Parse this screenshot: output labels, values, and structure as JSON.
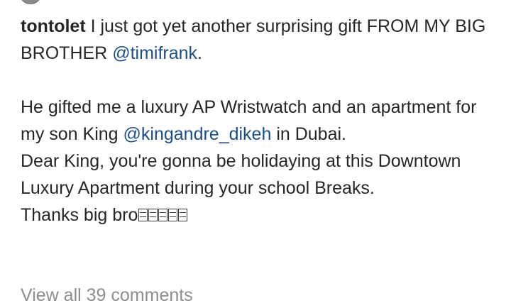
{
  "post": {
    "username": "tontolet",
    "caption": {
      "line1_text": " I just got yet another surprising gift FROM MY BIG BROTHER  ",
      "mention1": "@timifrank",
      "line1_end": ".",
      "para2_start": "He gifted me a luxury AP Wristwatch and an apartment for my son King ",
      "mention2": "@kingandre_dikeh",
      "para2_end": "  in Dubai.",
      "para3": "Dear King, you're gonna be holidaying at this Downtown Luxury Apartment during your school Breaks.",
      "para4": "Thanks big bro",
      "emoji_count": 5
    }
  },
  "comments": {
    "view_all_label": "View all 39 comments"
  }
}
